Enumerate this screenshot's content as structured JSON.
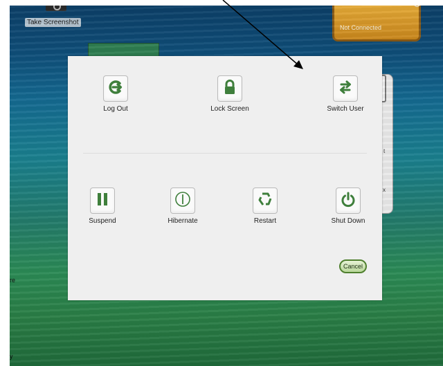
{
  "desktop": {
    "screenshot_launcher": {
      "label": "Take Screenshot"
    },
    "network_widget": {
      "status": "Not Connected"
    },
    "edge_texts": [
      "re",
      "y"
    ],
    "side_glyphs": [
      "t",
      "x"
    ]
  },
  "dialog": {
    "top_actions": [
      {
        "label": "Log Out",
        "icon": "logout-icon"
      },
      {
        "label": "Lock Screen",
        "icon": "lock-icon"
      },
      {
        "label": "Switch User",
        "icon": "switch-user-icon"
      }
    ],
    "bottom_actions": [
      {
        "label": "Suspend",
        "icon": "suspend-icon"
      },
      {
        "label": "Hibernate",
        "icon": "hibernate-icon"
      },
      {
        "label": "Restart",
        "icon": "restart-icon"
      },
      {
        "label": "Shut Down",
        "icon": "power-icon"
      }
    ],
    "cancel_label": "Cancel",
    "accent_color": "#3f7f3c"
  }
}
